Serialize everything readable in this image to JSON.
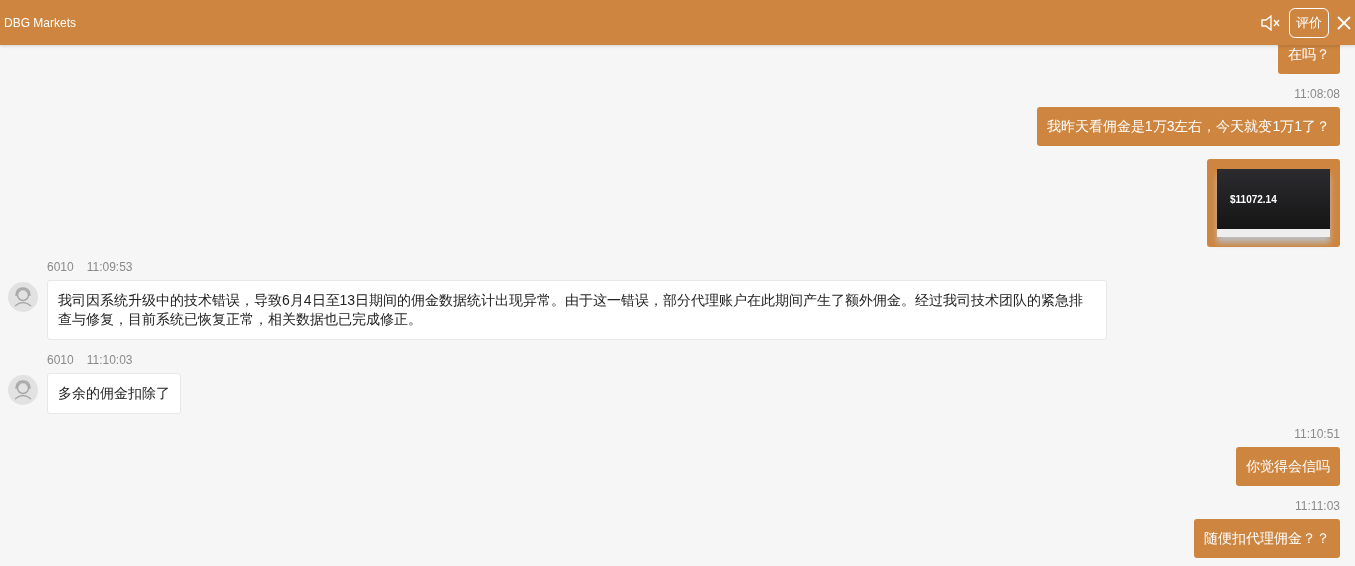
{
  "header": {
    "title": "DBG Markets",
    "rate_button": "评价",
    "muted": true
  },
  "messages": [
    {
      "kind": "outgoing",
      "text": "在吗？"
    },
    {
      "kind": "outgoing",
      "time": "11:08:08",
      "text": "我昨天看佣金是1万3左右，今天就变1万1了？"
    },
    {
      "kind": "image",
      "amount": "$11072.14"
    },
    {
      "kind": "incoming",
      "sender": "6010",
      "time": "11:09:53",
      "text": "我司因系统升级中的技术错误，导致6月4日至13日期间的佣金数据统计出现异常。由于这一错误，部分代理账户在此期间产生了额外佣金。经过我司技术团队的紧急排查与修复，目前系统已恢复正常，相关数据也已完成修正。"
    },
    {
      "kind": "incoming",
      "sender": "6010",
      "time": "11:10:03",
      "text": "多余的佣金扣除了"
    },
    {
      "kind": "outgoing",
      "time": "11:10:51",
      "text": "你觉得会信吗"
    },
    {
      "kind": "outgoing",
      "time": "11:11:03",
      "text": "随便扣代理佣金？？"
    }
  ]
}
